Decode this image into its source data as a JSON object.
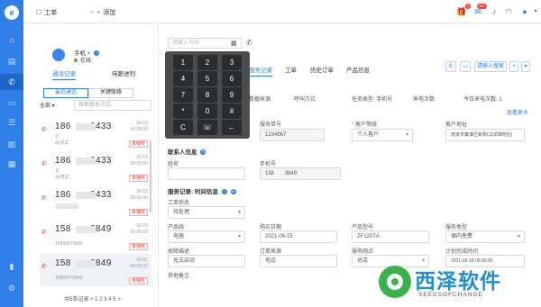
{
  "top_tabs": [
    {
      "label": "工单",
      "icon": "ticket-icon"
    },
    {
      "label": "添加",
      "icon": "plus-icon"
    }
  ],
  "top_right": {
    "gift_badge": "1",
    "msg_badge": "99+"
  },
  "user": {
    "name": "手机",
    "status": "在线"
  },
  "left_tabs": [
    "通话记录",
    "待跟进列"
  ],
  "segments": [
    "最近通话",
    "关键联络"
  ],
  "filter_label": "全部",
  "search_placeholder": "搜索联系方式",
  "calls": [
    {
      "num_a": "186",
      "num_b": "0433",
      "sub1": "北",
      "sub2": "dy测试",
      "date": "06-15",
      "time": "00:00:00",
      "tag": "未接听"
    },
    {
      "num_a": "186",
      "num_b": "0433",
      "sub1": "北",
      "sub2": "dy测试",
      "date": "06-15",
      "time": "00:00:00",
      "tag": "未接听"
    },
    {
      "num_a": "186",
      "num_b": "0433",
      "sub1": "",
      "sub2": "",
      "date": "06-15",
      "time": "00:00:00",
      "tag": "未接听"
    },
    {
      "num_a": "158",
      "num_b": "0849",
      "sub1": "",
      "sub2": "15850570849",
      "date": "06-15",
      "time": "00:00:00",
      "tag": "未接听"
    },
    {
      "num_a": "158",
      "num_b": "0849",
      "sub1": "",
      "sub2": "15850570849",
      "date": "06-01",
      "time": "00:00:00",
      "tag": "未接听"
    }
  ],
  "pager": "共5条记录 < 1 2 3 4 5 >",
  "dialer": {
    "placeholder": "请输入号码"
  },
  "main_tabs": [
    "服务记录",
    "工单",
    "历史订单",
    "产品信息"
  ],
  "toolbar": {
    "search_label": "请输入搜索"
  },
  "info_row": [
    "最后通话",
    "数据来源",
    "呼叫方式",
    "任务类型: 手机号",
    "来电次数",
    "今日来电次数: 1"
  ],
  "view_more": "查看更多",
  "form": {
    "contact_no_label": "服务单号",
    "contact_no_value": "1234567",
    "customer_level_label": "客户等级",
    "customer_level_value": "个人客户",
    "customer_addr_label": "客户地址",
    "customer_addr_value": "南京市秦淮区新街口(详细地址)",
    "contact_section": "联系人信息",
    "name_label": "姓名",
    "phone_label": "手机号",
    "phone_a": "158",
    "phone_b": "0849",
    "service_section": "服务记录: 时间信息",
    "handler_label": "工单状态",
    "handler_value": "待处理",
    "product_label": "产品线",
    "product_value": "电器",
    "buy_date_label": "购买日期",
    "buy_date_value": "2021-06-15",
    "model_label": "产品型号",
    "model_value": "ZF1207A",
    "service_type_label": "服务类型",
    "service_type_value": "保内免费",
    "reason_label": "故障描述",
    "reason_value": "无法启动",
    "order_from_label": "订单来源",
    "order_from_value": "电话",
    "unit_label": "服务网点",
    "unit_value": "总店",
    "deadline_label": "计划完成时间",
    "deadline_value": "2021-06-18 00:00:00",
    "remark_label": "其他备注"
  },
  "keypad": [
    "1",
    "2",
    "3",
    "4",
    "5",
    "6",
    "7",
    "8",
    "9",
    "*",
    "0",
    "#",
    "C",
    "☏",
    "←"
  ],
  "watermark": {
    "cn": "西泽软件",
    "en": "SEEDSOFCHANGE"
  }
}
